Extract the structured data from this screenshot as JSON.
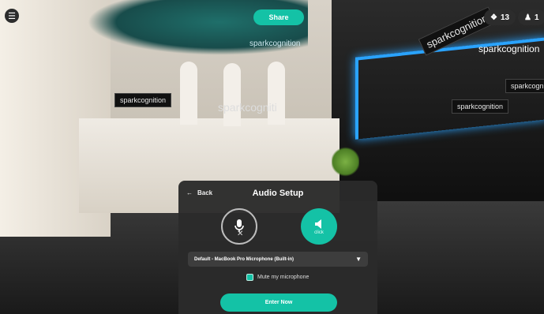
{
  "topbar": {
    "menu_icon": "hamburger-icon",
    "share_label": "Share",
    "visitors_icon": "nodes-icon",
    "visitors_count": "13",
    "users_icon": "people-icon",
    "users_count": "1"
  },
  "scene": {
    "signs": [
      "sparkcognition",
      "sparkcogniti",
      "sparkcognition",
      "sparkcognition",
      "sparkcognition",
      "sparkcognition",
      "sparkcognition"
    ]
  },
  "audio_setup": {
    "back_label": "Back",
    "title": "Audio Setup",
    "microphone_icon": "microphone-muted-icon",
    "speaker_icon": "speaker-icon",
    "speaker_hint": "click",
    "device_selected": "Default - MacBook Pro Microphone (Built-in)",
    "mute_label": "Mute my microphone",
    "mute_checked": true,
    "enter_label": "Enter Now"
  },
  "colors": {
    "accent": "#14c2a6",
    "panel_bg": "#2b2b2b"
  }
}
